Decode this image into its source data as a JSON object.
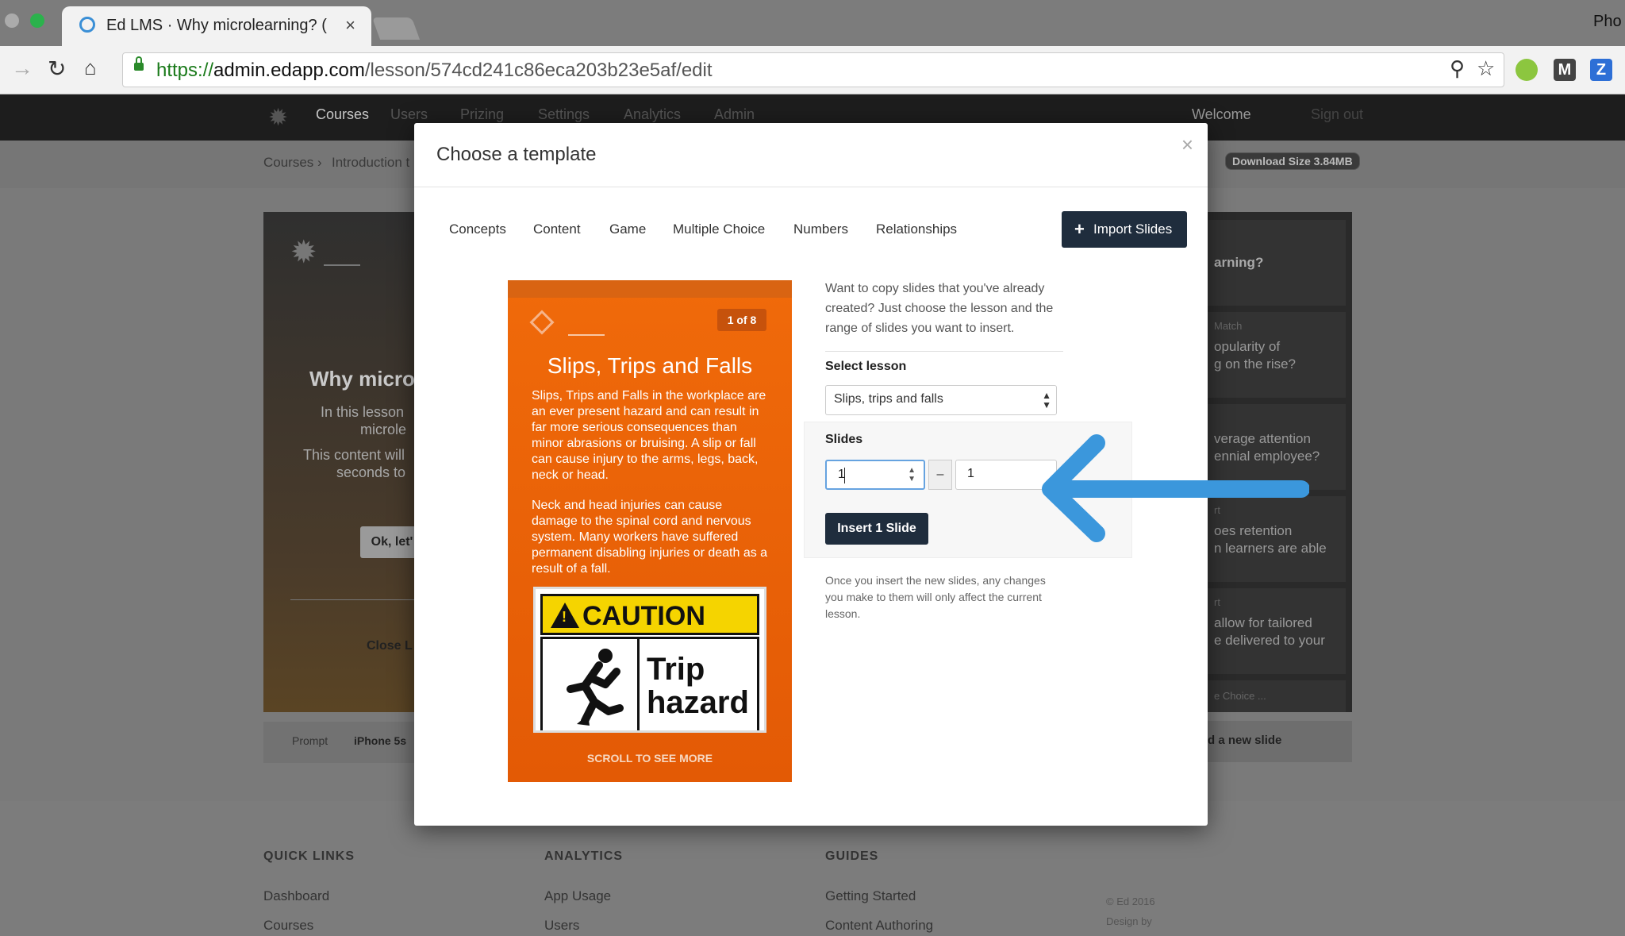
{
  "browser": {
    "tab_title": "Ed LMS · Why microlearning? (",
    "tab_close": "×",
    "profile_name": "Pho",
    "url_scheme": "https://",
    "url_host": "admin.edapp.com",
    "url_path": "/lesson/574cd241c86eca203b23e5af/edit",
    "extensions": [
      "M",
      "Z"
    ]
  },
  "app_nav": {
    "items": [
      "Courses",
      "Users",
      "Prizing",
      "Settings",
      "Analytics",
      "Admin"
    ],
    "welcome": "Welcome",
    "signout": "Sign out"
  },
  "breadcrumb": [
    "Courses",
    "›",
    "Introduction t"
  ],
  "download_badge": "Download Size 3.84MB",
  "lesson_preview": {
    "title": "Why micro",
    "line1": "In this lesson",
    "line2": "microle",
    "line3": "This content will",
    "line4": "seconds to",
    "button": "Ok, let'",
    "close": "Close L",
    "footer_prompt": "Prompt",
    "footer_device": "iPhone 5s"
  },
  "right_panel": {
    "cards": [
      {
        "title": "arning?"
      },
      {
        "sub": "Match",
        "line1": "opularity of",
        "line2": "g on the rise?"
      },
      {
        "line1": "verage attention",
        "line2": "ennial employee?"
      },
      {
        "sub": "rt",
        "line1": "oes retention",
        "line2": "n learners are able"
      },
      {
        "sub": "rt",
        "line1": "allow for tailored",
        "line2": "e delivered to your"
      },
      {
        "sub": "e Choice ..."
      }
    ],
    "add_slide": "d a new slide"
  },
  "footer": {
    "quick_links": {
      "title": "QUICK LINKS",
      "links": [
        "Dashboard",
        "Courses"
      ]
    },
    "analytics": {
      "title": "ANALYTICS",
      "links": [
        "App Usage",
        "Users"
      ]
    },
    "guides": {
      "title": "GUIDES",
      "links": [
        "Getting Started",
        "Content Authoring"
      ]
    },
    "copyright": "© Ed 2016",
    "design_by": "Design by"
  },
  "modal": {
    "title": "Choose a template",
    "close": "×",
    "tabs": [
      "Concepts",
      "Content",
      "Game",
      "Multiple Choice",
      "Numbers",
      "Relationships"
    ],
    "import_button": "Import Slides",
    "description": "Want to copy slides that you've already created? Just choose the lesson and the range of slides you want to insert.",
    "select_lesson_label": "Select lesson",
    "selected_lesson": "Slips, trips and falls",
    "slides_label": "Slides",
    "range_from": "1",
    "range_separator": "–",
    "range_to": "1",
    "insert_button": "Insert 1 Slide",
    "note": "Once you insert the new slides, any changes you make to them will only affect the current lesson."
  },
  "slide_preview": {
    "counter": "1 of 8",
    "title": "Slips, Trips and Falls",
    "para1": "Slips, Trips and Falls in the workplace are an ever present hazard and can result in far more serious consequences than minor abrasions or bruising. A slip or fall can cause injury to the arms, legs, back, neck or head.",
    "para2": "Neck and head injuries can cause damage to the spinal cord and nervous system. Many workers have suffered permanent disabling injuries or death as a result of a fall.",
    "sign_word": "CAUTION",
    "sign_line1": "Trip",
    "sign_line2": "hazard",
    "scroll_hint": "SCROLL TO SEE MORE"
  },
  "colors": {
    "slide_orange": "#f06a0a",
    "dark_button": "#1f2d3d",
    "callout_arrow": "#3b97dc"
  }
}
